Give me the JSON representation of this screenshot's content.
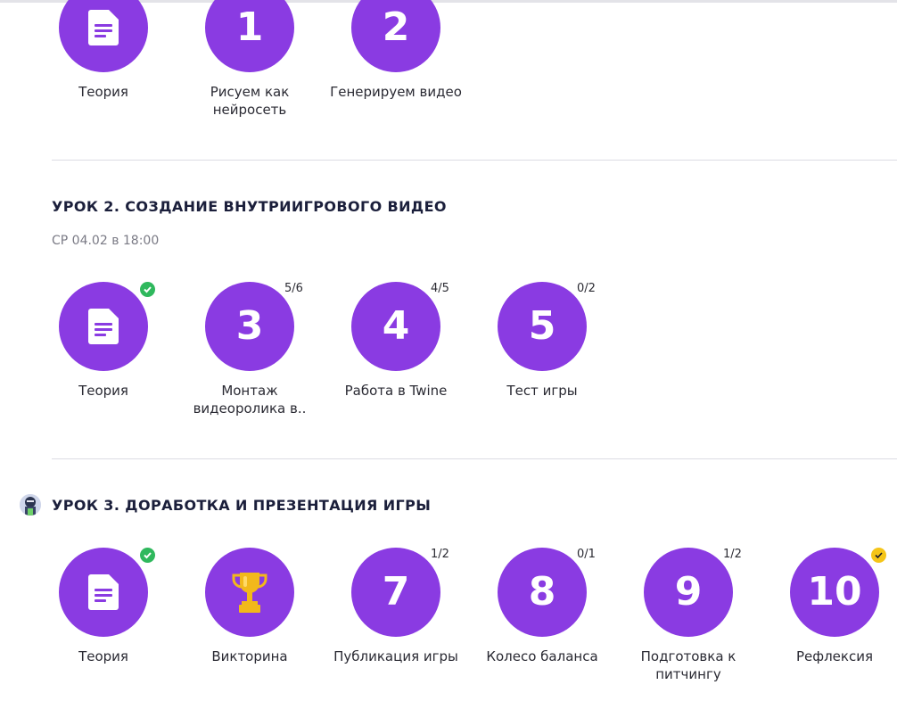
{
  "lesson1": {
    "items": [
      {
        "kind": "doc",
        "label": "Теория"
      },
      {
        "kind": "num",
        "number": "1",
        "label": "Рисуем как нейросеть"
      },
      {
        "kind": "num",
        "number": "2",
        "label": "Генерируем видео"
      }
    ]
  },
  "lesson2": {
    "title": "УРОК 2. СОЗДАНИЕ ВНУТРИИГРОВОГО ВИДЕО",
    "date": "СР 04.02 в 18:00",
    "items": [
      {
        "kind": "doc",
        "label": "Теория",
        "status": "done"
      },
      {
        "kind": "num",
        "number": "3",
        "label": "Монтаж видеоролика в..",
        "progress": "5/6"
      },
      {
        "kind": "num",
        "number": "4",
        "label": "Работа в Twine",
        "progress": "4/5"
      },
      {
        "kind": "num",
        "number": "5",
        "label": "Тест игры",
        "progress": "0/2"
      }
    ]
  },
  "lesson3": {
    "title": "УРОК 3. ДОРАБОТКА И ПРЕЗЕНТАЦИЯ ИГРЫ",
    "items": [
      {
        "kind": "doc",
        "label": "Теория",
        "status": "done"
      },
      {
        "kind": "trophy",
        "label": "Викторина"
      },
      {
        "kind": "num",
        "number": "7",
        "label": "Публикация игры",
        "progress": "1/2"
      },
      {
        "kind": "num",
        "number": "8",
        "label": "Колесо баланса",
        "progress": "0/1"
      },
      {
        "kind": "num",
        "number": "9",
        "label": "Подготовка к питчингу",
        "progress": "1/2"
      },
      {
        "kind": "num",
        "number": "10",
        "label": "Рефлексия",
        "status": "review"
      }
    ]
  },
  "colors": {
    "accent": "#8a3be2",
    "done": "#2fb85d",
    "review": "#f5c518",
    "trophy": "#f2b81b"
  }
}
